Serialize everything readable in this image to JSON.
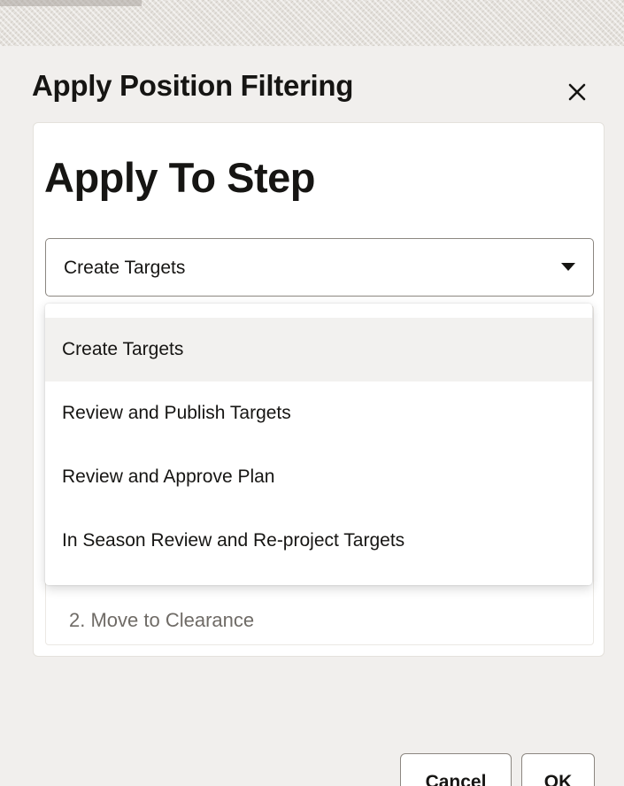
{
  "dialog": {
    "title": "Apply Position Filtering",
    "close_icon": "close-icon"
  },
  "section": {
    "heading": "Apply To Step"
  },
  "step_select": {
    "value": "Create Targets",
    "icon": "caret-down-icon",
    "options": [
      {
        "label": "Create Targets",
        "selected": true
      },
      {
        "label": "Review and Publish Targets",
        "selected": false
      },
      {
        "label": "Review and Approve Plan",
        "selected": false
      },
      {
        "label": "In Season Review and Re-project Targets",
        "selected": false
      }
    ]
  },
  "underlay": {
    "item": "2. Move to Clearance"
  },
  "footer": {
    "cancel_label": "Cancel",
    "ok_label": "OK"
  },
  "colors": {
    "text": "#161513",
    "dialog_bg": "#f1efed",
    "selected_option_bg": "#f2f1ef",
    "border": "#8c8781"
  }
}
